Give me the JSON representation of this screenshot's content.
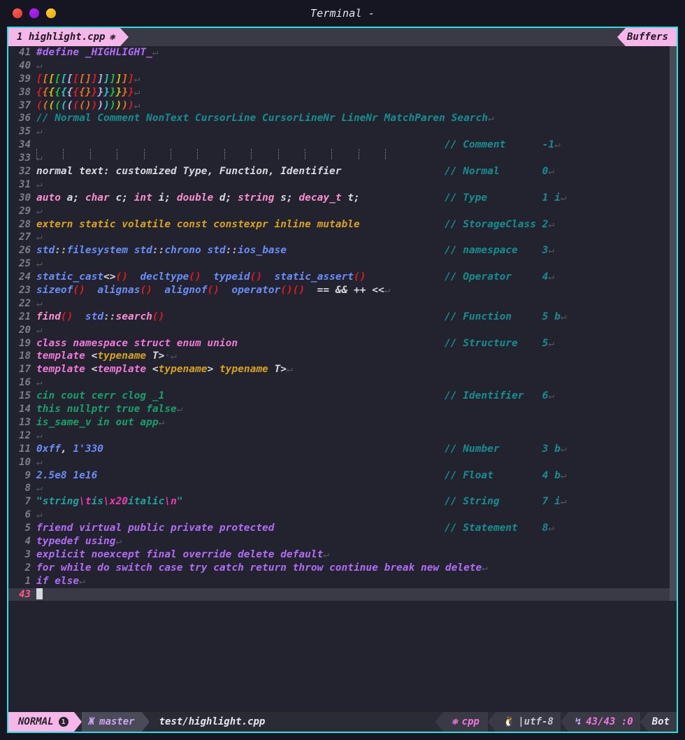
{
  "window": {
    "title": "Terminal -",
    "traffic_lights": [
      "close-red",
      "minimize-purple",
      "maximize-yellow"
    ]
  },
  "tabline": {
    "tab_label": "1 highlight.cpp",
    "tab_icon": "cpp-icon",
    "buffers_label": "Buffers"
  },
  "editor": {
    "cursor_line_number": "43",
    "filetype": "cpp",
    "lines": [
      {
        "num": "41",
        "segments": [
          {
            "t": "#define _HIGHLIGHT_",
            "c": "c-preproc"
          },
          {
            "t": "↵",
            "c": "c-nontext"
          }
        ]
      },
      {
        "num": "40",
        "segments": [
          {
            "t": "↵",
            "c": "c-nontext"
          }
        ]
      },
      {
        "num": "39",
        "segments": [
          {
            "t": "[",
            "c": "rb1"
          },
          {
            "t": "[",
            "c": "rb2"
          },
          {
            "t": "[",
            "c": "rb3"
          },
          {
            "t": "[",
            "c": "rb4"
          },
          {
            "t": "[",
            "c": "rb5"
          },
          {
            "t": "[",
            "c": "rb6"
          },
          {
            "t": "[",
            "c": "rb1"
          },
          {
            "t": "[",
            "c": "rb2"
          },
          {
            "t": "]",
            "c": "rb2"
          },
          {
            "t": "]",
            "c": "rb1"
          },
          {
            "t": "]",
            "c": "rb6"
          },
          {
            "t": "]",
            "c": "rb5"
          },
          {
            "t": "]",
            "c": "rb4"
          },
          {
            "t": "]",
            "c": "rb3"
          },
          {
            "t": "]",
            "c": "rb2"
          },
          {
            "t": "]",
            "c": "rb1"
          },
          {
            "t": "↵",
            "c": "c-nontext"
          }
        ]
      },
      {
        "num": "38",
        "segments": [
          {
            "t": "{",
            "c": "rb1"
          },
          {
            "t": "{",
            "c": "rb2"
          },
          {
            "t": "{",
            "c": "rb3"
          },
          {
            "t": "{",
            "c": "rb4"
          },
          {
            "t": "{",
            "c": "rb5"
          },
          {
            "t": "{",
            "c": "rb6"
          },
          {
            "t": "{",
            "c": "rb1"
          },
          {
            "t": "{",
            "c": "rb2"
          },
          {
            "t": "}",
            "c": "rb2"
          },
          {
            "t": "}",
            "c": "rb1"
          },
          {
            "t": "}",
            "c": "rb6"
          },
          {
            "t": "}",
            "c": "rb5"
          },
          {
            "t": "}",
            "c": "rb4"
          },
          {
            "t": "}",
            "c": "rb3"
          },
          {
            "t": "}",
            "c": "rb2"
          },
          {
            "t": "}",
            "c": "rb1"
          },
          {
            "t": "↵",
            "c": "c-nontext"
          }
        ]
      },
      {
        "num": "37",
        "segments": [
          {
            "t": "(",
            "c": "rb1"
          },
          {
            "t": "(",
            "c": "rb2"
          },
          {
            "t": "(",
            "c": "rb3"
          },
          {
            "t": "(",
            "c": "rb4"
          },
          {
            "t": "(",
            "c": "rb5"
          },
          {
            "t": "(",
            "c": "rb6"
          },
          {
            "t": "(",
            "c": "rb1"
          },
          {
            "t": "(",
            "c": "rb2"
          },
          {
            "t": ")",
            "c": "rb2"
          },
          {
            "t": ")",
            "c": "rb1"
          },
          {
            "t": ")",
            "c": "rb6"
          },
          {
            "t": ")",
            "c": "rb5"
          },
          {
            "t": ")",
            "c": "rb4"
          },
          {
            "t": ")",
            "c": "rb3"
          },
          {
            "t": ")",
            "c": "rb2"
          },
          {
            "t": ")",
            "c": "rb1"
          },
          {
            "t": "↵",
            "c": "c-nontext"
          }
        ]
      },
      {
        "num": "36",
        "segments": [
          {
            "t": "// Normal Comment NonText CursorLine CursorLineNr LineNr MatchParen Search",
            "c": "c-comment"
          },
          {
            "t": "↵",
            "c": "c-nontext"
          }
        ]
      },
      {
        "num": "35",
        "segments": [
          {
            "t": "↵",
            "c": "c-nontext"
          }
        ]
      },
      {
        "num": "34",
        "indent_guides": 14,
        "comment": "// Comment",
        "comment_value": "-1",
        "segments": []
      },
      {
        "num": "33",
        "segments": [
          {
            "t": "↵",
            "c": "c-nontext"
          }
        ]
      },
      {
        "num": "32",
        "comment": "// Normal",
        "comment_value": "0",
        "segments": [
          {
            "t": "normal text: customized Type, Function, Identifier",
            "c": "c-normal"
          }
        ]
      },
      {
        "num": "31",
        "segments": [
          {
            "t": "↵",
            "c": "c-nontext"
          }
        ]
      },
      {
        "num": "30",
        "comment": "// Type",
        "comment_value": "1 i",
        "segments": [
          {
            "t": "auto",
            "c": "c-type"
          },
          {
            "t": " a; ",
            "c": "c-normal"
          },
          {
            "t": "char",
            "c": "c-type"
          },
          {
            "t": " c; ",
            "c": "c-normal"
          },
          {
            "t": "int",
            "c": "c-type"
          },
          {
            "t": " i; ",
            "c": "c-normal"
          },
          {
            "t": "double",
            "c": "c-type"
          },
          {
            "t": " d; ",
            "c": "c-normal"
          },
          {
            "t": "string",
            "c": "c-type"
          },
          {
            "t": " s; ",
            "c": "c-normal"
          },
          {
            "t": "decay_t",
            "c": "c-type"
          },
          {
            "t": " t;",
            "c": "c-normal"
          }
        ]
      },
      {
        "num": "29",
        "segments": [
          {
            "t": "↵",
            "c": "c-nontext"
          }
        ]
      },
      {
        "num": "28",
        "comment": "// StorageClass",
        "comment_value": "2",
        "segments": [
          {
            "t": "extern static volatile const constexpr inline mutable",
            "c": "c-storage"
          }
        ]
      },
      {
        "num": "27",
        "segments": [
          {
            "t": "↵",
            "c": "c-nontext"
          }
        ]
      },
      {
        "num": "26",
        "comment": "// namespace",
        "comment_value": "3",
        "segments": [
          {
            "t": "std",
            "c": "c-namespace"
          },
          {
            "t": "::",
            "c": "c-punct"
          },
          {
            "t": "filesystem ",
            "c": "c-namespace"
          },
          {
            "t": "std",
            "c": "c-namespace"
          },
          {
            "t": "::",
            "c": "c-punct"
          },
          {
            "t": "chrono ",
            "c": "c-namespace"
          },
          {
            "t": "std",
            "c": "c-namespace"
          },
          {
            "t": "::",
            "c": "c-punct"
          },
          {
            "t": "ios_base",
            "c": "c-namespace"
          }
        ]
      },
      {
        "num": "25",
        "segments": [
          {
            "t": "↵",
            "c": "c-nontext"
          }
        ]
      },
      {
        "num": "24",
        "comment": "// Operator",
        "comment_value": "4",
        "segments": [
          {
            "t": "static_cast",
            "c": "c-operator"
          },
          {
            "t": "<>",
            "c": "c-normal"
          },
          {
            "t": "()",
            "c": "c-opparen"
          },
          {
            "t": "  ",
            "c": "c-normal"
          },
          {
            "t": "decltype",
            "c": "c-operator"
          },
          {
            "t": "()",
            "c": "c-opparen"
          },
          {
            "t": "  ",
            "c": "c-normal"
          },
          {
            "t": "typeid",
            "c": "c-operator"
          },
          {
            "t": "()",
            "c": "c-opparen"
          },
          {
            "t": "  ",
            "c": "c-normal"
          },
          {
            "t": "static_assert",
            "c": "c-operator"
          },
          {
            "t": "()",
            "c": "c-opparen"
          }
        ]
      },
      {
        "num": "23",
        "segments": [
          {
            "t": "sizeof",
            "c": "c-operator"
          },
          {
            "t": "()",
            "c": "c-opparen"
          },
          {
            "t": "  ",
            "c": "c-normal"
          },
          {
            "t": "alignas",
            "c": "c-operator"
          },
          {
            "t": "()",
            "c": "c-opparen"
          },
          {
            "t": "  ",
            "c": "c-normal"
          },
          {
            "t": "alignof",
            "c": "c-operator"
          },
          {
            "t": "()",
            "c": "c-opparen"
          },
          {
            "t": "  ",
            "c": "c-normal"
          },
          {
            "t": "operator",
            "c": "c-operator"
          },
          {
            "t": "()()",
            "c": "c-opparen"
          },
          {
            "t": "  == && ++ <<",
            "c": "c-normal"
          },
          {
            "t": "↵",
            "c": "c-nontext"
          }
        ]
      },
      {
        "num": "22",
        "segments": [
          {
            "t": "↵",
            "c": "c-nontext"
          }
        ]
      },
      {
        "num": "21",
        "comment": "// Function",
        "comment_value": "5 b",
        "segments": [
          {
            "t": "find",
            "c": "c-func"
          },
          {
            "t": "()",
            "c": "c-opparen"
          },
          {
            "t": "  ",
            "c": "c-normal"
          },
          {
            "t": "std",
            "c": "c-namespace"
          },
          {
            "t": "::",
            "c": "c-punct"
          },
          {
            "t": "search",
            "c": "c-func"
          },
          {
            "t": "()",
            "c": "c-opparen"
          }
        ]
      },
      {
        "num": "20",
        "segments": [
          {
            "t": "↵",
            "c": "c-nontext"
          }
        ]
      },
      {
        "num": "19",
        "comment": "// Structure",
        "comment_value": "5",
        "segments": [
          {
            "t": "class namespace struct enum union",
            "c": "c-structure"
          }
        ]
      },
      {
        "num": "18",
        "segments": [
          {
            "t": "template",
            "c": "c-structure"
          },
          {
            "t": " <",
            "c": "c-normal"
          },
          {
            "t": "typename",
            "c": "c-template"
          },
          {
            "t": " T>",
            "c": "c-normal"
          },
          {
            "t": "·",
            "c": "c-nontext"
          },
          {
            "t": "↵",
            "c": "c-nontext"
          }
        ]
      },
      {
        "num": "17",
        "segments": [
          {
            "t": "template",
            "c": "c-structure"
          },
          {
            "t": " <",
            "c": "c-normal"
          },
          {
            "t": "template",
            "c": "c-structure"
          },
          {
            "t": " <",
            "c": "c-normal"
          },
          {
            "t": "typename",
            "c": "c-template"
          },
          {
            "t": "> ",
            "c": "c-normal"
          },
          {
            "t": "typename",
            "c": "c-template"
          },
          {
            "t": " T>",
            "c": "c-normal"
          },
          {
            "t": "↵",
            "c": "c-nontext"
          }
        ]
      },
      {
        "num": "16",
        "segments": [
          {
            "t": "↵",
            "c": "c-nontext"
          }
        ]
      },
      {
        "num": "15",
        "comment": "// Identifier",
        "comment_value": "6",
        "segments": [
          {
            "t": "cin cout cerr clog _1",
            "c": "c-ident"
          }
        ]
      },
      {
        "num": "14",
        "segments": [
          {
            "t": "this nullptr true false",
            "c": "c-ident"
          },
          {
            "t": "↵",
            "c": "c-nontext"
          }
        ]
      },
      {
        "num": "13",
        "segments": [
          {
            "t": "is_same_v in out app",
            "c": "c-ident"
          },
          {
            "t": "↵",
            "c": "c-nontext"
          }
        ]
      },
      {
        "num": "12",
        "segments": [
          {
            "t": "↵",
            "c": "c-nontext"
          }
        ]
      },
      {
        "num": "11",
        "comment": "// Number",
        "comment_value": "3 b",
        "segments": [
          {
            "t": "0xff",
            "c": "c-number"
          },
          {
            "t": ", ",
            "c": "c-normal"
          },
          {
            "t": "1'330",
            "c": "c-number"
          }
        ]
      },
      {
        "num": "10",
        "segments": [
          {
            "t": "↵",
            "c": "c-nontext"
          }
        ]
      },
      {
        "num": "9",
        "comment": "// Float",
        "comment_value": "4 b",
        "segments": [
          {
            "t": "2.5e8 1e16",
            "c": "c-float"
          }
        ]
      },
      {
        "num": "8",
        "segments": [
          {
            "t": "↵",
            "c": "c-nontext"
          }
        ]
      },
      {
        "num": "7",
        "comment": "// String",
        "comment_value": "7 i",
        "segments": [
          {
            "t": "\"string",
            "c": "c-string"
          },
          {
            "t": "\\t",
            "c": "c-escape"
          },
          {
            "t": "is",
            "c": "c-string"
          },
          {
            "t": "\\x20",
            "c": "c-escape"
          },
          {
            "t": "italic",
            "c": "c-string"
          },
          {
            "t": "\\n",
            "c": "c-escape"
          },
          {
            "t": "\"",
            "c": "c-string"
          }
        ]
      },
      {
        "num": "6",
        "segments": [
          {
            "t": "↵",
            "c": "c-nontext"
          }
        ]
      },
      {
        "num": "5",
        "comment": "// Statement",
        "comment_value": "8",
        "segments": [
          {
            "t": "friend virtual public private protected",
            "c": "c-statement"
          }
        ]
      },
      {
        "num": "4",
        "segments": [
          {
            "t": "typedef using",
            "c": "c-statement"
          },
          {
            "t": "↵",
            "c": "c-nontext"
          }
        ]
      },
      {
        "num": "3",
        "segments": [
          {
            "t": "explicit noexcept final override delete default",
            "c": "c-statement"
          },
          {
            "t": "↵",
            "c": "c-nontext"
          }
        ]
      },
      {
        "num": "2",
        "segments": [
          {
            "t": "for while do switch case try catch return throw continue break new delete",
            "c": "c-statement"
          },
          {
            "t": "↵",
            "c": "c-nontext"
          }
        ]
      },
      {
        "num": "1",
        "segments": [
          {
            "t": "if else",
            "c": "c-statement"
          },
          {
            "t": "↵",
            "c": "c-nontext"
          }
        ]
      }
    ]
  },
  "statusline": {
    "mode": "NORMAL",
    "mode_badge": "1",
    "git_icon": "git-branch-icon",
    "git_branch": "master",
    "file_path": "test/highlight.cpp",
    "filetype_icon": "cpp-icon",
    "filetype": "cpp",
    "os_icon": "linux-penguin-icon",
    "encoding": "|utf-8",
    "lineending_icon": "line-ending-icon",
    "position": "43/43 :0",
    "scroll_percent": "Bot"
  },
  "colors": {
    "accent_pink": "#f7b6e8",
    "comment_teal": "#138f8f",
    "bg_editor": "#232330",
    "bg_window": "#161622",
    "border_cyan": "#2de0e0"
  }
}
